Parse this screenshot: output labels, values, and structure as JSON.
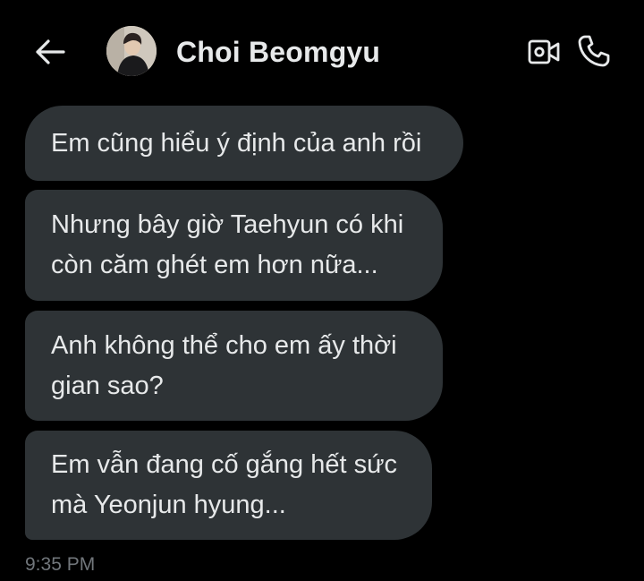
{
  "header": {
    "contact_name": "Choi Beomgyu",
    "back_icon": "arrow-left-icon",
    "video_icon": "video-camera-icon",
    "call_icon": "phone-icon"
  },
  "messages": [
    {
      "text": "Em cũng hiểu ý định của anh rồi"
    },
    {
      "text": "Nhưng bây giờ Taehyun có khi\ncòn căm ghét em hơn nữa..."
    },
    {
      "text": "Anh không thể cho em ấy thời\ngian sao?"
    },
    {
      "text": "Em vẫn đang cố gắng hết sức\nmà Yeonjun hyung..."
    }
  ],
  "timestamp": "9:35 PM",
  "colors": {
    "background": "#000000",
    "bubble": "#2e3336",
    "text": "#e7e9ea",
    "muted": "#71767b"
  }
}
